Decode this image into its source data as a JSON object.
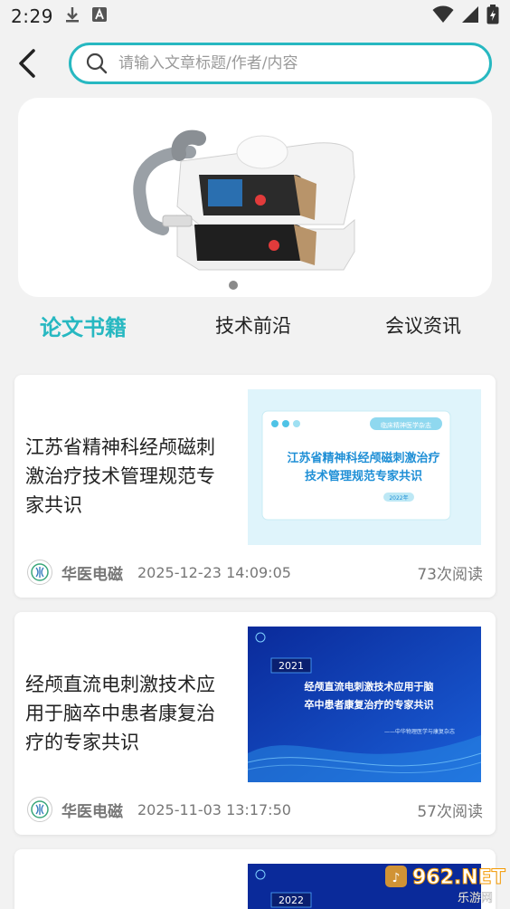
{
  "status": {
    "time": "2:29"
  },
  "search": {
    "placeholder": "请输入文章标题/作者/内容"
  },
  "tabs": [
    {
      "label": "论文书籍",
      "active": true
    },
    {
      "label": "技术前沿",
      "active": false
    },
    {
      "label": "会议资讯",
      "active": false
    }
  ],
  "articles": [
    {
      "title": "江苏省精神科经颅磁刺激治疗技术管理规范专家共识",
      "author": "华医电磁",
      "date": "2025-12-23 14:09:05",
      "reads": "73次阅读",
      "thumb": {
        "tag": "临床精神医学杂志",
        "line1": "江苏省精神科经颅磁刺激治疗",
        "line2": "技术管理规范专家共识",
        "year": "2022年"
      }
    },
    {
      "title": "经颅直流电刺激技术应用于脑卒中患者康复治疗的专家共识",
      "author": "华医电磁",
      "date": "2025-11-03 13:17:50",
      "reads": "57次阅读",
      "thumb": {
        "year": "2021",
        "line1": "经颅直流电刺激技术应用于脑",
        "line2": "卒中患者康复治疗的专家共识",
        "source": "——中华物理医学与康复杂志"
      }
    },
    {
      "thumb": {
        "year": "2022"
      }
    }
  ],
  "watermark": {
    "brand": "962.NET",
    "sub": "乐游网"
  },
  "colors": {
    "accent": "#27b8c1",
    "thumb2_bg": "#0a2a9a"
  }
}
